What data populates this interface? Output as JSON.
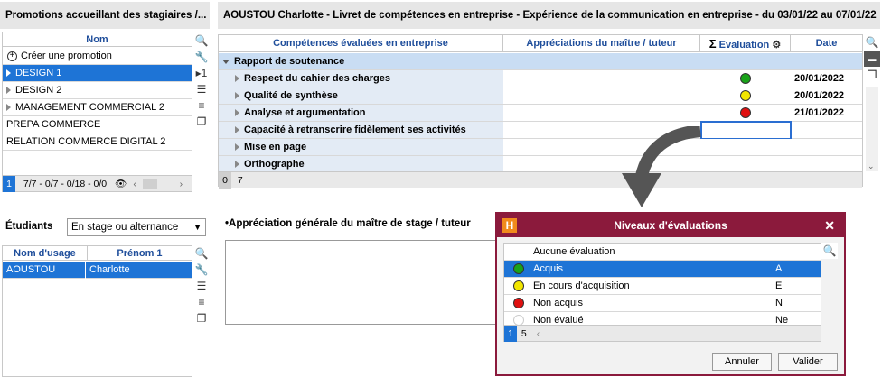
{
  "left_panel": {
    "title": "Promotions accueillant des stagiaires /...",
    "col_nom": "Nom",
    "create_label": "Créer une promotion",
    "items": [
      {
        "label": "DESIGN 1"
      },
      {
        "label": "DESIGN 2"
      },
      {
        "label": "MANAGEMENT COMMERCIAL 2"
      },
      {
        "label": "PREPA COMMERCE"
      },
      {
        "label": "RELATION COMMERCE DIGITAL 2"
      }
    ],
    "footer": {
      "page": "1",
      "counts": "7/7 - 0/7 - 0/18 - 0/0"
    }
  },
  "students": {
    "label": "Étudiants",
    "filter_value": "En stage ou alternance",
    "col_nom": "Nom d'usage",
    "col_prenom": "Prénom 1",
    "rows": [
      {
        "nom": "AOUSTOU",
        "prenom": "Charlotte"
      }
    ]
  },
  "main": {
    "title": "AOUSTOU Charlotte - Livret de compétences en entreprise - Expérience de la communication en entreprise - du 03/01/22 au 07/01/22",
    "col_competences": "Compétences évaluées en entreprise",
    "col_appreciations": "Appréciations du maître / tuteur",
    "col_evaluation": "Evaluation",
    "col_date": "Date",
    "group_label": "Rapport de soutenance",
    "rows": [
      {
        "label": "Respect du cahier des charges",
        "eval_color": "#1aa31a",
        "date": "20/01/2022"
      },
      {
        "label": "Qualité de synthèse",
        "eval_color": "#f2e600",
        "date": "20/01/2022"
      },
      {
        "label": "Analyse et argumentation",
        "eval_color": "#e01010",
        "date": "21/01/2022"
      },
      {
        "label": "Capacité à retranscrire fidèlement ses activités",
        "eval_color": "",
        "date": ""
      },
      {
        "label": "Mise en page",
        "eval_color": "",
        "date": ""
      },
      {
        "label": "Orthographe",
        "eval_color": "",
        "date": ""
      }
    ],
    "footer": {
      "left": "0",
      "count": "7"
    },
    "appreciation_label": "•Appréciation générale du maître de stage / tuteur"
  },
  "dialog": {
    "title": "Niveaux d'évaluations",
    "col_label": "Aucune évaluation",
    "items": [
      {
        "label": "Acquis",
        "code": "A",
        "color": "#1aa31a"
      },
      {
        "label": "En cours d'acquisition",
        "code": "E",
        "color": "#f2e600"
      },
      {
        "label": "Non acquis",
        "code": "N",
        "color": "#e01010"
      },
      {
        "label": "Non évalué",
        "code": "Ne",
        "color": "#ffffff"
      }
    ],
    "footer": {
      "page": "1",
      "count": "5"
    },
    "cancel_label": "Annuler",
    "ok_label": "Valider",
    "app_letter": "H"
  }
}
